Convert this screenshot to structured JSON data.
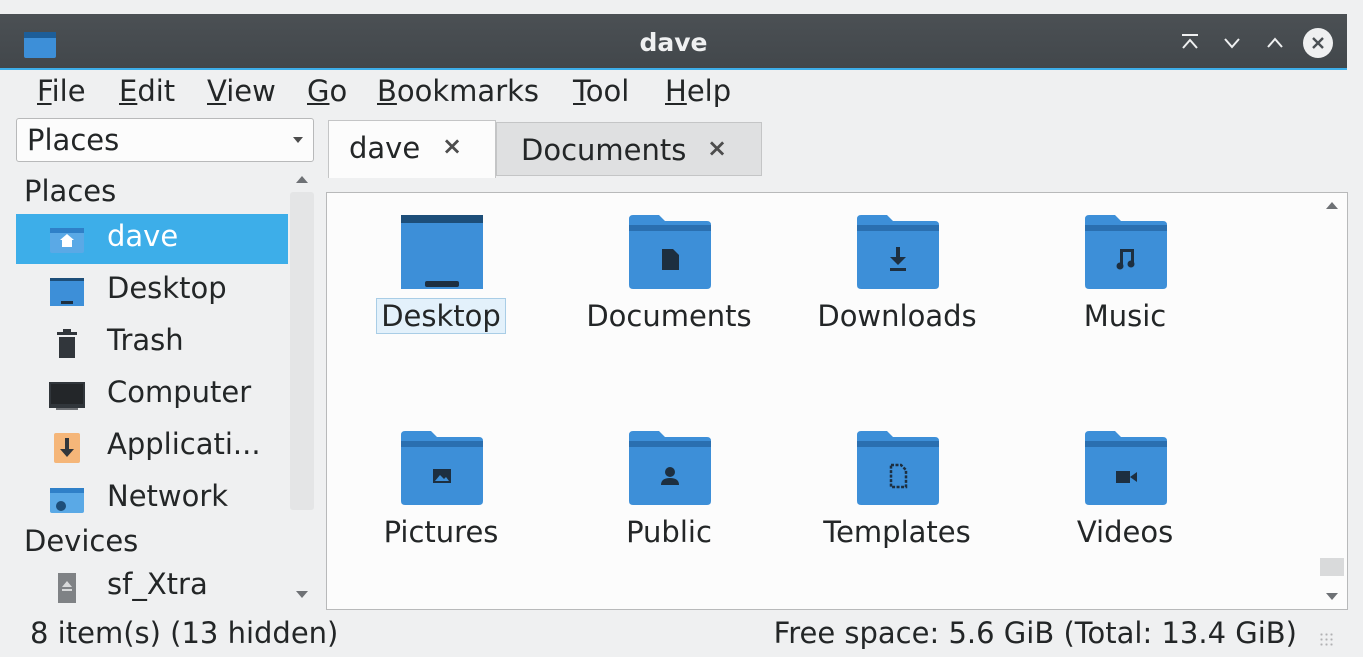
{
  "window": {
    "title": "dave",
    "accent": "#3daee9",
    "controls": [
      "keep-above-icon",
      "minimize-icon",
      "maximize-icon",
      "close-icon"
    ]
  },
  "menubar": {
    "items": [
      {
        "mnemonic": "F",
        "rest": "ile"
      },
      {
        "mnemonic": "E",
        "rest": "dit"
      },
      {
        "mnemonic": "V",
        "rest": "iew"
      },
      {
        "mnemonic": "G",
        "rest": "o"
      },
      {
        "mnemonic": "B",
        "rest": "ookmarks"
      },
      {
        "mnemonic": "T",
        "rest": "ool"
      },
      {
        "mnemonic": "H",
        "rest": "elp"
      }
    ]
  },
  "sidebar": {
    "combo_value": "Places",
    "places_header": "Places",
    "devices_header": "Devices",
    "items": [
      {
        "label": "dave",
        "icon": "home-folder-icon",
        "selected": true
      },
      {
        "label": "Desktop",
        "icon": "desktop-icon",
        "selected": false
      },
      {
        "label": "Trash",
        "icon": "trash-icon",
        "selected": false
      },
      {
        "label": "Computer",
        "icon": "computer-icon",
        "selected": false
      },
      {
        "label": "Applicati...",
        "icon": "applications-icon",
        "selected": false
      },
      {
        "label": "Network",
        "icon": "network-folder-icon",
        "selected": false
      },
      {
        "label": "sf_Xtra",
        "icon": "drive-icon",
        "selected": false
      }
    ]
  },
  "tabs": [
    {
      "label": "dave",
      "close": "×",
      "active": true
    },
    {
      "label": "Documents",
      "close": "×",
      "active": false
    }
  ],
  "files": [
    {
      "label": "Desktop",
      "icon": "desktop-folder-icon"
    },
    {
      "label": "Documents",
      "icon": "documents-folder-icon"
    },
    {
      "label": "Downloads",
      "icon": "downloads-folder-icon"
    },
    {
      "label": "Music",
      "icon": "music-folder-icon"
    },
    {
      "label": "Pictures",
      "icon": "pictures-folder-icon"
    },
    {
      "label": "Public",
      "icon": "public-folder-icon"
    },
    {
      "label": "Templates",
      "icon": "templates-folder-icon"
    },
    {
      "label": "Videos",
      "icon": "videos-folder-icon"
    }
  ],
  "status": {
    "left": "8 item(s) (13 hidden)",
    "right": "Free space: 5.6 GiB (Total: 13.4 GiB)"
  }
}
